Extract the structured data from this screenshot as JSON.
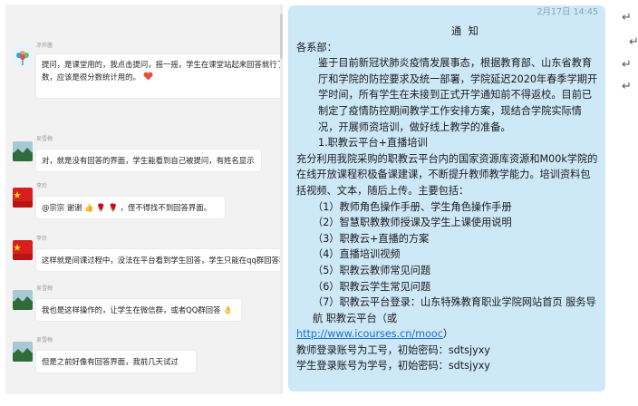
{
  "chat": {
    "messages": [
      {
        "sender": "凉拌菌",
        "avatar": "flower-avatar",
        "lines": [
          "提问，是课堂用的，我点击提问，摇一摇，学生在课堂站起来回答就行了，",
          "数，应该是很分数统计用的。"
        ],
        "emoji": "heart-emoji"
      },
      {
        "sender": "吴雪梅",
        "avatar": "landscape-avatar",
        "lines": [
          "对，就是没有回答的界面，学生能看到自己被提问，有姓名显示"
        ]
      },
      {
        "sender": "李玲",
        "avatar": "flag-avatar",
        "lines": [
          "@宗宗 谢谢",
          "，侄不得找不到回答界面。"
        ]
      },
      {
        "sender": "李玲",
        "avatar": "flag-avatar",
        "lines": [
          "这样就是间课过程中，没法在平台看到学生回答，学生只能在qq群回答和"
        ]
      },
      {
        "sender": "吴雪梅",
        "avatar": "landscape-avatar",
        "lines": [
          "我也是这样操作的，让学生在微信群，或者QQ群回答"
        ]
      },
      {
        "sender": "吴雪梅",
        "avatar": "landscape-avatar",
        "lines": [
          "但是之前好像有回答界面，我前几天试过"
        ]
      }
    ]
  },
  "notice": {
    "timestamp": "2月17日 14:45",
    "title": "通  知",
    "salutation": "各系部：",
    "para1": "鉴于目前新冠状肺炎疫情发展事态，根据教育部、山东省教育厅和学院的防控要求及统一部署，学院延迟2020年春季学期开学时间，所有学生在未接到正式开学通知前不得返校。目前已制定了疫情防控期间教学工作安排方案，现结合学院实际情况，开展师资培训，做好线上教学的准备。",
    "section1": "1.职教云平台+直播培训",
    "para2": "充分利用我院采购的职教云平台内的国家资源库资源和M00k学院的在线开放课程积极备课建课，不断提升教师教学能力。培训资料包括视频、文本，随后上传。主要包括：",
    "items": [
      "（1）教师角色操作手册、学生角色操作手册",
      "（2）智慧职教教师授课及学生上课使用说明",
      "（3）职教云+直播的方案",
      "（4）直播培训视频",
      "（5）职教云教师常见问题",
      "（6）职教云学生常见问题"
    ],
    "item7": "（7）职教云平台登录：山东特殊教育职业学院网站首页  服务导航  职教云平台（或",
    "link": "http://www.icourses.cn/mooc",
    "link_close": "）",
    "teacher_login": "教师登录账号为工号，初始密码：sdtsjyxy",
    "student_login": "学生登录账号为学号，初始密码：sdtsjyxy"
  },
  "markers": [
    "↵",
    "↵",
    "↵",
    "↵"
  ]
}
